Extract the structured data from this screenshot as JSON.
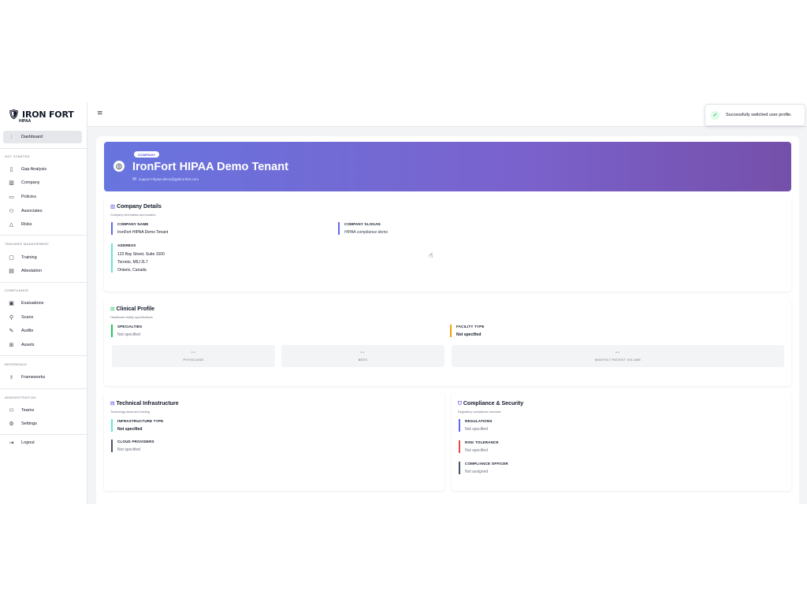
{
  "brand": {
    "name": "IRON FORT",
    "product": "HIPAA",
    "logo_icon": "shield-icon"
  },
  "sidebar": {
    "items": [
      {
        "label": "Dashboard",
        "icon": "chart-icon"
      }
    ],
    "sections": [
      {
        "title": "GET STARTED",
        "items": [
          {
            "label": "Gap Analysis",
            "icon": "clipboard-icon"
          },
          {
            "label": "Company",
            "icon": "bar-chart-icon"
          },
          {
            "label": "Policies",
            "icon": "folder-icon"
          },
          {
            "label": "Associates",
            "icon": "users-icon"
          },
          {
            "label": "Risks",
            "icon": "warning-icon"
          }
        ]
      },
      {
        "title": "TRAINING MANAGEMENT",
        "items": [
          {
            "label": "Training",
            "icon": "monitor-icon"
          },
          {
            "label": "Attestation",
            "icon": "document-icon"
          }
        ]
      },
      {
        "title": "COMPLIANCE",
        "items": [
          {
            "label": "Evaluations",
            "icon": "file-check-icon"
          },
          {
            "label": "Scans",
            "icon": "search-icon"
          },
          {
            "label": "Audits",
            "icon": "edit-icon"
          },
          {
            "label": "Assets",
            "icon": "network-icon"
          }
        ]
      },
      {
        "title": "REFERENCE",
        "items": [
          {
            "label": "Frameworks",
            "icon": "sliders-icon"
          }
        ]
      },
      {
        "title": "ADMINISTRATION",
        "items": [
          {
            "label": "Teams",
            "icon": "team-icon"
          },
          {
            "label": "Settings",
            "icon": "gear-icon"
          }
        ]
      }
    ],
    "logout": {
      "label": "Logout",
      "icon": "logout-icon"
    }
  },
  "toast": {
    "message": "Successfully switched user profile."
  },
  "banner": {
    "badge": "COMPANY",
    "title": "IronFort HIPAA Demo Tenant",
    "email": "support+hipaa-demo@getironfort.com"
  },
  "company_details": {
    "title": "Company Details",
    "subtitle": "Company information and location",
    "name_label": "COMPANY NAME",
    "name_value": "IronFort HIPAA Demo Tenant",
    "slogan_label": "COMPANY SLOGAN",
    "slogan_value": "HIPAA compliance demo",
    "address_label": "ADDRESS",
    "address_lines": [
      "123 Bay Street, Suite 1500",
      "Toronto, M5J 2L7",
      "Ontario, Canada"
    ]
  },
  "clinical_profile": {
    "title": "Clinical Profile",
    "subtitle": "Healthcare facility specifications",
    "specialties_label": "SPECIALTIES",
    "specialties_value": "Not specified",
    "facility_label": "FACILITY TYPE",
    "facility_value": "Not specified",
    "stats": [
      {
        "value": "--",
        "label": "PHYSICIANS"
      },
      {
        "value": "--",
        "label": "BEDS"
      },
      {
        "value": "--",
        "label": "MONTHLY PATIENT VOLUME"
      }
    ]
  },
  "technical_infrastructure": {
    "title": "Technical Infrastructure",
    "subtitle": "Technology stack and hosting",
    "infra_label": "INFRASTRUCTURE TYPE",
    "infra_value": "Not specified",
    "cloud_label": "CLOUD PROVIDERS",
    "cloud_value": "Not specified"
  },
  "compliance_security": {
    "title": "Compliance & Security",
    "subtitle": "Regulatory compliance overview",
    "regulations_label": "REGULATIONS",
    "regulations_value": "Not specified",
    "risk_label": "RISK TOLERANCE",
    "risk_value": "Not specified",
    "officer_label": "COMPLIANCE OFFICER",
    "officer_value": "Not assigned"
  },
  "colors": {
    "accent": "#6366f1",
    "banner_start": "#6875df",
    "banner_end": "#7550aa",
    "green": "#22c55e",
    "orange": "#f59e0b",
    "red": "#ef4444",
    "slate": "#475569"
  }
}
